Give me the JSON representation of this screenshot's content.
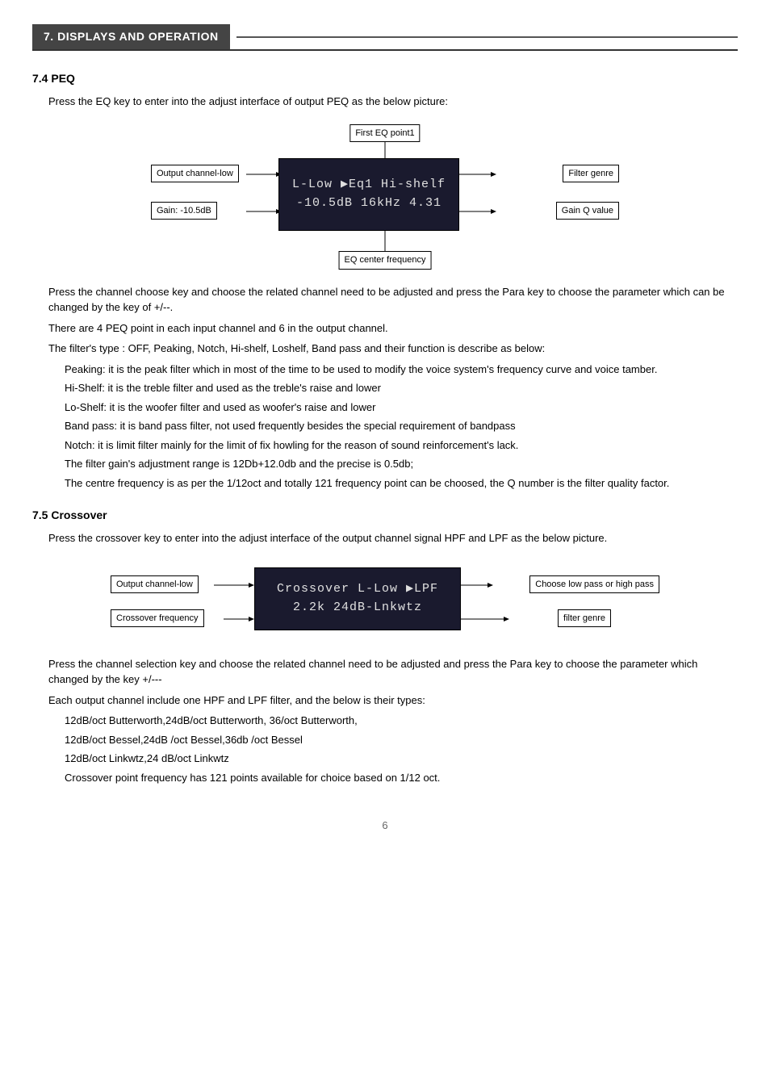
{
  "header": {
    "section_number": "7.",
    "section_title": "DISPLAYS AND OPERATION"
  },
  "section_74": {
    "title": "7.4 PEQ",
    "intro": "Press the EQ key to enter into the adjust interface of output PEQ as the below picture:",
    "diagram": {
      "screen_line1": "L-Low ▶Eq1 Hi-shelf",
      "screen_line2": "-10.5dB  16kHz  4.31",
      "label_top": "First EQ point1",
      "label_left_top": "Output channel-low",
      "label_left_bottom": "Gain: -10.5dB",
      "label_right_top": "Filter genre",
      "label_right_bottom": "Gain Q value",
      "label_bottom": "EQ center frequency"
    },
    "paragraphs": [
      "Press the channel choose key and choose the related channel need to be adjusted and press the Para key to choose the parameter which can be changed by the key of +/--.",
      "There are 4 PEQ point in each input channel and 6 in the output channel.",
      "The filter's type : OFF, Peaking, Notch, Hi-shelf, Loshelf, Band pass and their function is describe as below:"
    ],
    "bullet_items": [
      "Peaking: it is the peak filter which in most of the time to be used to modify the voice system's frequency curve and voice tamber.",
      "Hi-Shelf: it is the treble filter and used as the treble's raise and lower",
      "Lo-Shelf: it is the woofer filter and used as woofer's raise and lower",
      "Band pass: it is band pass filter, not used frequently besides the special requirement of bandpass",
      "Notch: it is limit filter mainly for the limit of fix howling for the reason of sound reinforcement's lack.",
      "The filter gain's adjustment range is 12Db+12.0db and the precise is 0.5db;",
      "The centre frequency is as per the 1/12oct and totally 121 frequency point can be choosed, the Q number is the filter quality factor."
    ]
  },
  "section_75": {
    "title": "7.5 Crossover",
    "intro": "Press  the crossover key to enter into the adjust interface of the output channel signal HPF and LPF as the below picture.",
    "diagram": {
      "screen_line1": "Crossover L-Low ▶LPF",
      "screen_line2": "2.2k  24dB-Lnkwtz",
      "label_left_top": "Output channel-low",
      "label_left_bottom": "Crossover frequency",
      "label_right_top": "Choose low pass or high pass",
      "label_right_bottom": "filter genre"
    },
    "paragraphs": [
      "Press the channel selection  key and choose the related channel need to be adjusted and press the Para key to choose the parameter which changed by the key +/---",
      "Each output channel include one HPF and LPF filter, and the below is their types:"
    ],
    "bullet_items": [
      "12dB/oct Butterworth,24dB/oct Butterworth, 36/oct Butterworth,",
      "12dB/oct Bessel,24dB /oct Bessel,36db /oct Bessel",
      "12dB/oct Linkwtz,24 dB/oct Linkwtz",
      "Crossover point frequency has 121 points available for choice based on 1/12 oct."
    ]
  },
  "page_number": "6"
}
